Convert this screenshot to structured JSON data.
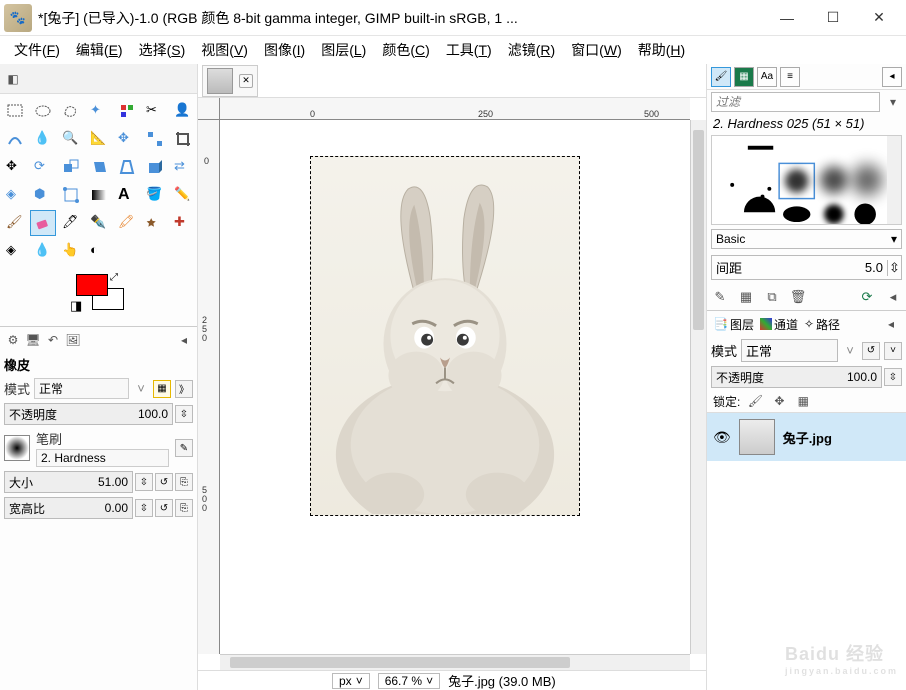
{
  "window": {
    "title": "*[兔子] (已导入)-1.0 (RGB 颜色 8-bit gamma integer, GIMP built-in sRGB, 1 ..."
  },
  "menu": {
    "items": [
      {
        "label": "文件",
        "key": "F"
      },
      {
        "label": "编辑",
        "key": "E"
      },
      {
        "label": "选择",
        "key": "S"
      },
      {
        "label": "视图",
        "key": "V"
      },
      {
        "label": "图像",
        "key": "I"
      },
      {
        "label": "图层",
        "key": "L"
      },
      {
        "label": "颜色",
        "key": "C"
      },
      {
        "label": "工具",
        "key": "T"
      },
      {
        "label": "滤镜",
        "key": "R"
      },
      {
        "label": "窗口",
        "key": "W"
      },
      {
        "label": "帮助",
        "key": "H"
      }
    ]
  },
  "colors": {
    "fg": "#ff0000",
    "bg": "#ffffff"
  },
  "tool_options": {
    "tool_name": "橡皮",
    "mode_label": "模式",
    "mode_value": "正常",
    "opacity_label": "不透明度",
    "opacity_value": "100.0",
    "brush_label": "笔刷",
    "brush_value": "2. Hardness",
    "size_label": "大小",
    "size_value": "51.00",
    "ratio_label": "宽高比",
    "ratio_value": "0.00"
  },
  "canvas": {
    "ruler_h": [
      "0",
      "250",
      "500"
    ],
    "ruler_v": [
      "0",
      "2\n5\n0",
      "5\n0\n0"
    ],
    "unit": "px",
    "zoom": "66.7 %",
    "filename": "兔子.jpg (39.0 MB)"
  },
  "right": {
    "filter_placeholder": "过滤",
    "brush_name": "2. Hardness 025 (51 × 51)",
    "brush_dynamics": "Basic",
    "spacing_label": "间距",
    "spacing_value": "5.0",
    "layers_tab": "图层",
    "channels_tab": "通道",
    "paths_tab": "路径",
    "mode_label": "模式",
    "mode_value": "正常",
    "opacity_label": "不透明度",
    "opacity_value": "100.0",
    "lock_label": "锁定:",
    "layer_name": "兔子.jpg"
  },
  "watermark": {
    "brand": "Baidu 经验",
    "url": "jingyan.baidu.com"
  }
}
